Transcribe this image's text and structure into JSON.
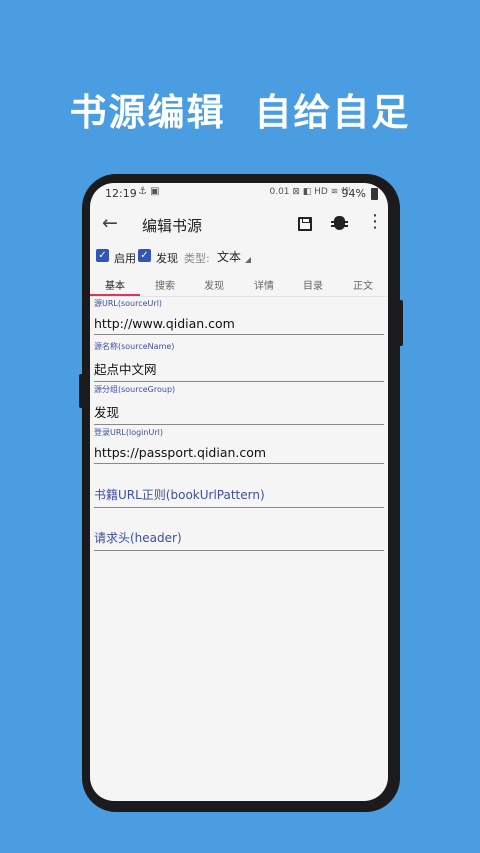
{
  "headline": "书源编辑 自给自足",
  "status": {
    "time": "12:19",
    "left_icons": "⚓ ▣",
    "right_icons": "0.01 ⊠ ◧ HD ≋ ⁴⁶ᴵ",
    "battery": "94%"
  },
  "toolbar": {
    "back_icon": "←",
    "title": "编辑书源",
    "more_icon": "⋮"
  },
  "options": {
    "enable_label": "启用",
    "discover_label": "发现",
    "type_label": "类型:",
    "type_value": "文本",
    "check_mark": "✓"
  },
  "tabs": [
    "基本",
    "搜索",
    "发现",
    "详情",
    "目录",
    "正文"
  ],
  "fields": [
    {
      "label": "源URL(sourceUrl)",
      "value": "http://www.qidian.com"
    },
    {
      "label": "源名称(sourceName)",
      "value": "起点中文网"
    },
    {
      "label": "源分组(sourceGroup)",
      "value": "发现"
    },
    {
      "label": "登录URL(loginUrl)",
      "value": "https://passport.qidian.com"
    }
  ],
  "hints": [
    {
      "placeholder": "书籍URL正则(bookUrlPattern)"
    },
    {
      "placeholder": "请求头(header)"
    }
  ]
}
